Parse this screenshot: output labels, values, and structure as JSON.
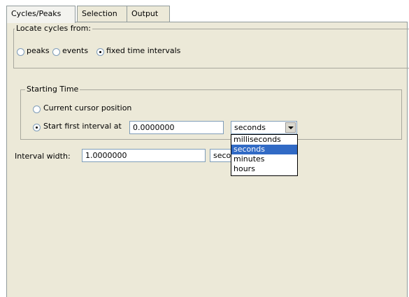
{
  "tabs": [
    {
      "label": "Cycles/Peaks",
      "active": true
    },
    {
      "label": "Selection",
      "active": false
    },
    {
      "label": "Output",
      "active": false
    }
  ],
  "locate": {
    "title": "Locate cycles from:",
    "options": [
      {
        "label": "peaks",
        "selected": false
      },
      {
        "label": "events",
        "selected": false
      },
      {
        "label": "fixed time intervals",
        "selected": true
      }
    ]
  },
  "starting_time": {
    "title": "Starting Time",
    "current_cursor_label": "Current cursor position",
    "start_first_label": "Start first interval at",
    "start_value": "0.0000000",
    "unit_selected": "seconds",
    "unit_options": [
      "milliseconds",
      "seconds",
      "minutes",
      "hours"
    ],
    "unit_highlighted": "seconds"
  },
  "interval": {
    "label": "Interval width:",
    "value": "1.0000000",
    "unit_visible": "seco"
  }
}
